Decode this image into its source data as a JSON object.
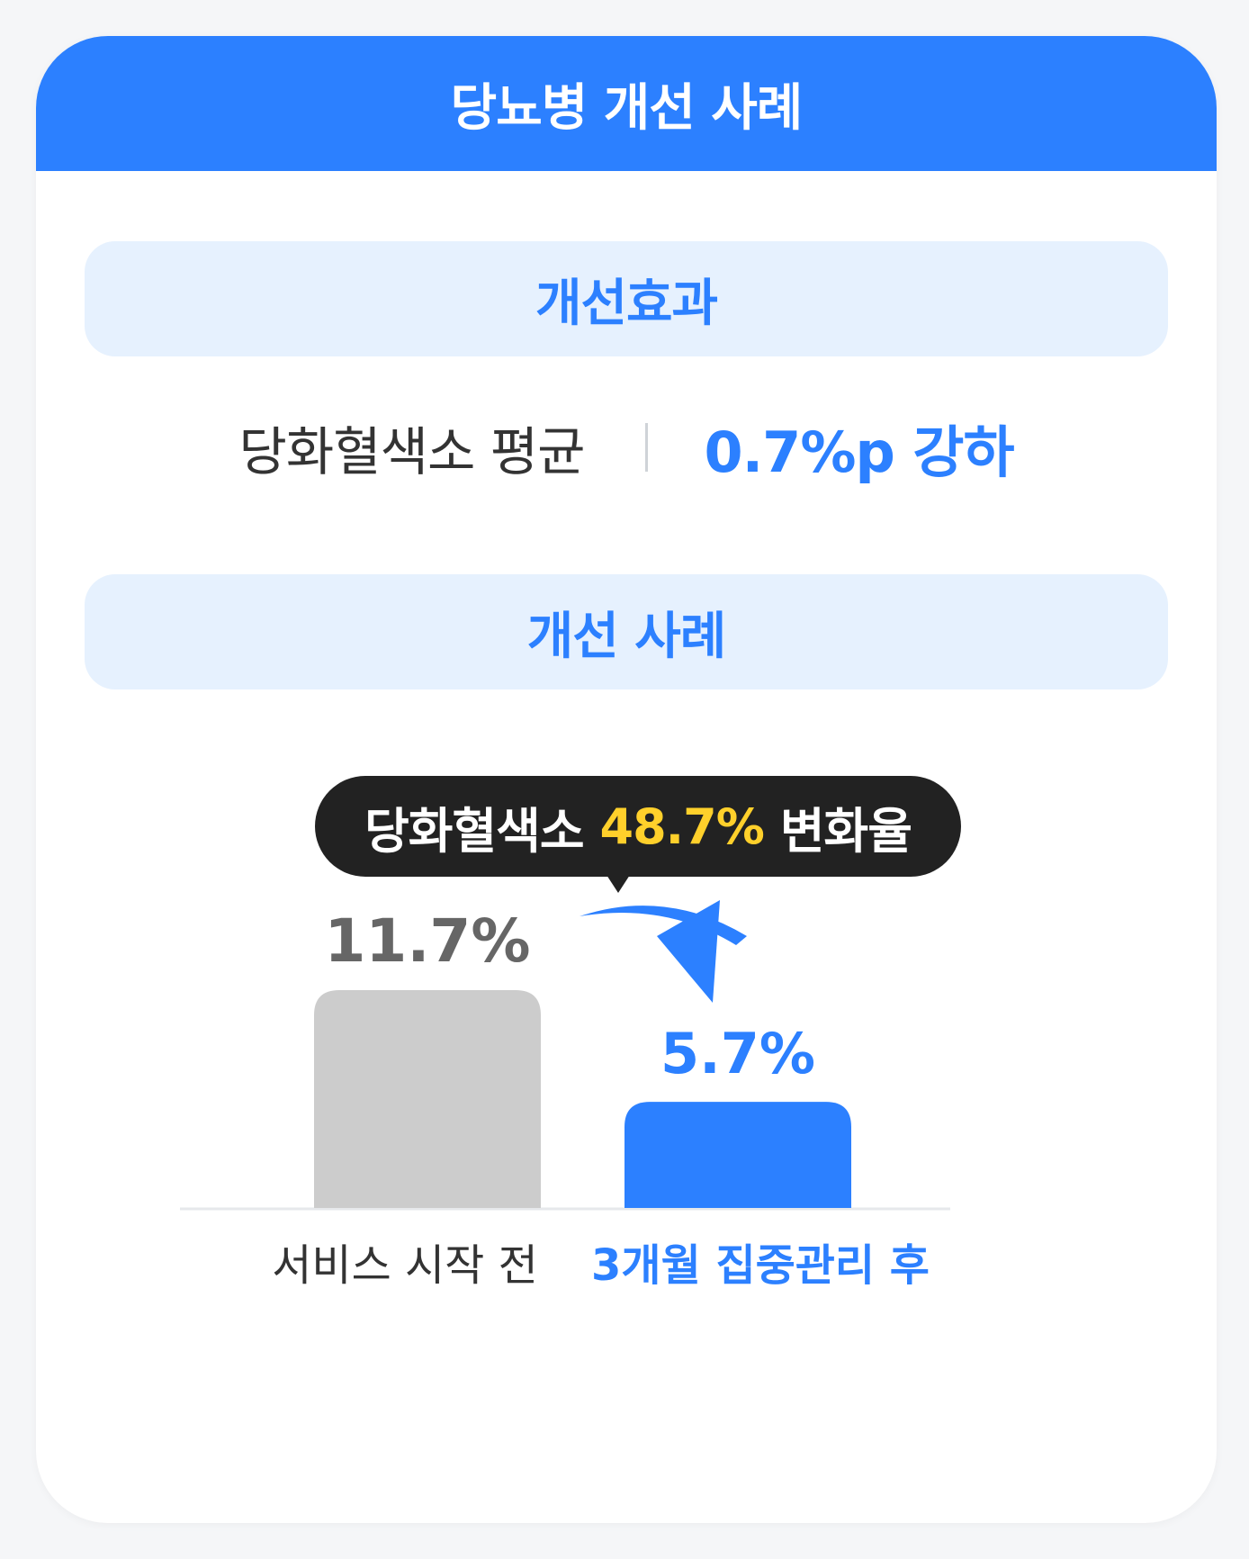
{
  "header": {
    "title": "당뇨병 개선 사례"
  },
  "effect_section": {
    "label": "개선효과",
    "metric": "당화혈색소 평균",
    "value": "0.7%p 강하"
  },
  "case_section": {
    "label": "개선 사례"
  },
  "tooltip": {
    "prefix": "당화혈색소",
    "highlight": "48.7%",
    "suffix": "변화율"
  },
  "colors": {
    "brand_blue": "#2c80ff",
    "label_bg": "#e6f1fe",
    "bar_before": "#cccccc",
    "highlight_yellow": "#ffd02b",
    "tooltip_bg": "#222222"
  },
  "chart_data": {
    "type": "bar",
    "categories": [
      "서비스 시작 전",
      "3개월 집중관리 후"
    ],
    "values": [
      11.7,
      5.7
    ],
    "value_labels": [
      "11.7%",
      "5.7%"
    ],
    "bar_colors": [
      "#cccccc",
      "#2c80ff"
    ],
    "label_colors": [
      "#666666",
      "#2c80ff"
    ],
    "category_colors": [
      "#333333",
      "#2c80ff"
    ],
    "ylim": [
      0,
      11.7
    ],
    "grid": false,
    "annotation": "arrow from first bar to second bar"
  }
}
